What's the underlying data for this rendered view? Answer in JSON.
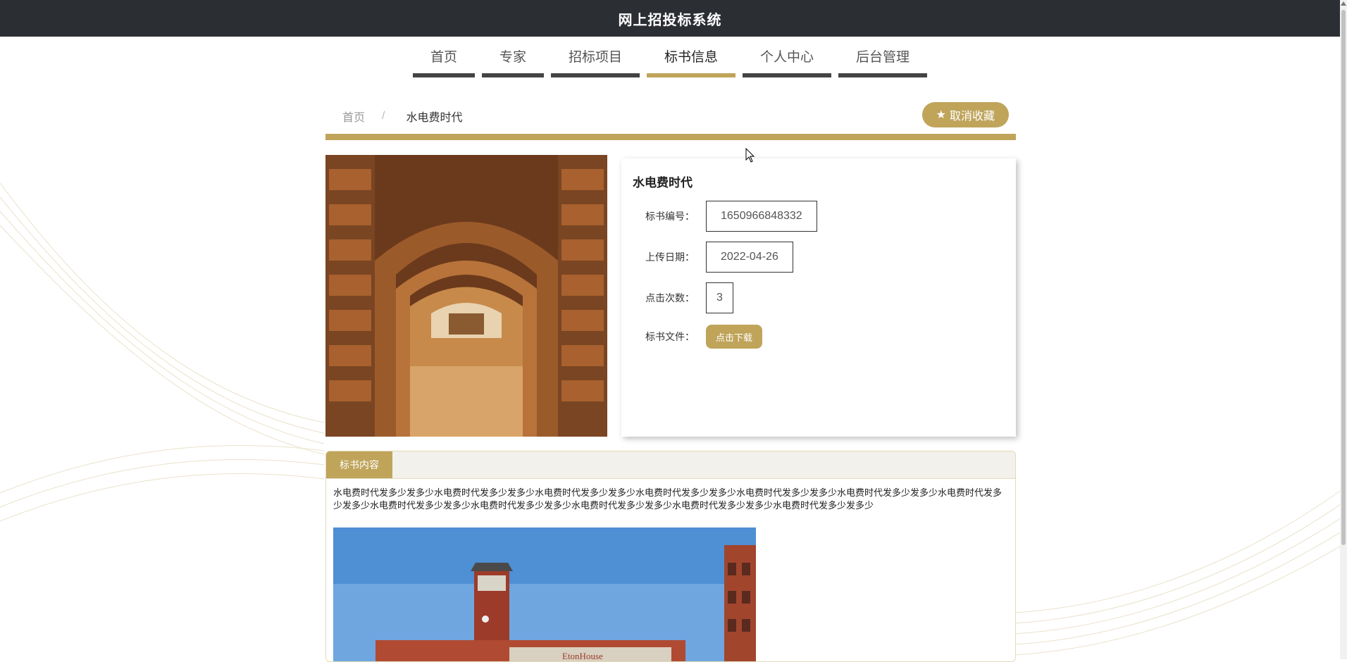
{
  "app": {
    "title": "网上招投标系统"
  },
  "nav": {
    "items": [
      {
        "label": "首页",
        "active": false
      },
      {
        "label": "专家",
        "active": false
      },
      {
        "label": "招标项目",
        "active": false
      },
      {
        "label": "标书信息",
        "active": true
      },
      {
        "label": "个人中心",
        "active": false
      },
      {
        "label": "后台管理",
        "active": false
      }
    ]
  },
  "breadcrumb": {
    "home": "首页",
    "separator": "/",
    "current": "水电费时代"
  },
  "favorite_button": {
    "label": "取消收藏",
    "icon": "star-icon"
  },
  "detail": {
    "title": "水电费时代",
    "fields": [
      {
        "label": "标书编号：",
        "value": "1650966848332"
      },
      {
        "label": "上传日期：",
        "value": "2022-04-26"
      },
      {
        "label": "点击次数：",
        "value": "3"
      }
    ],
    "file_label": "标书文件：",
    "download_label": "点击下载"
  },
  "content_section": {
    "tab_label": "标书内容",
    "text": "水电费时代发多少发多少水电费时代发多少发多少水电费时代发多少发多少水电费时代发多少发多少水电费时代发多少发多少水电费时代发多少发多少水电费时代发多少发多少水电费时代发多少发多少水电费时代发多少发多少水电费时代发多少发多少水电费时代发多少发多少水电费时代发多少发多少",
    "image_sign_text": "EtonHouse"
  },
  "colors": {
    "accent": "#bfa45a",
    "topbar": "#2b2e33",
    "nav_underline": "#444444"
  }
}
